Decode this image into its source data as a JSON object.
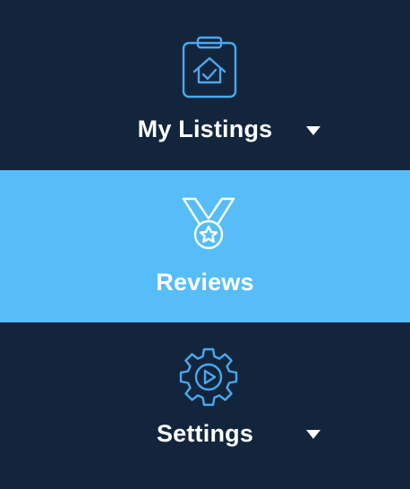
{
  "colors": {
    "background": "#13253d",
    "active_background": "#56bdf9",
    "icon_accent": "#4aa9f0",
    "text": "#ffffff"
  },
  "nav": {
    "items": [
      {
        "label": "My Listings",
        "icon": "clipboard-house-icon",
        "has_dropdown": true,
        "active": false
      },
      {
        "label": "Reviews",
        "icon": "medal-icon",
        "has_dropdown": false,
        "active": true
      },
      {
        "label": "Settings",
        "icon": "gear-play-icon",
        "has_dropdown": true,
        "active": false
      }
    ]
  }
}
